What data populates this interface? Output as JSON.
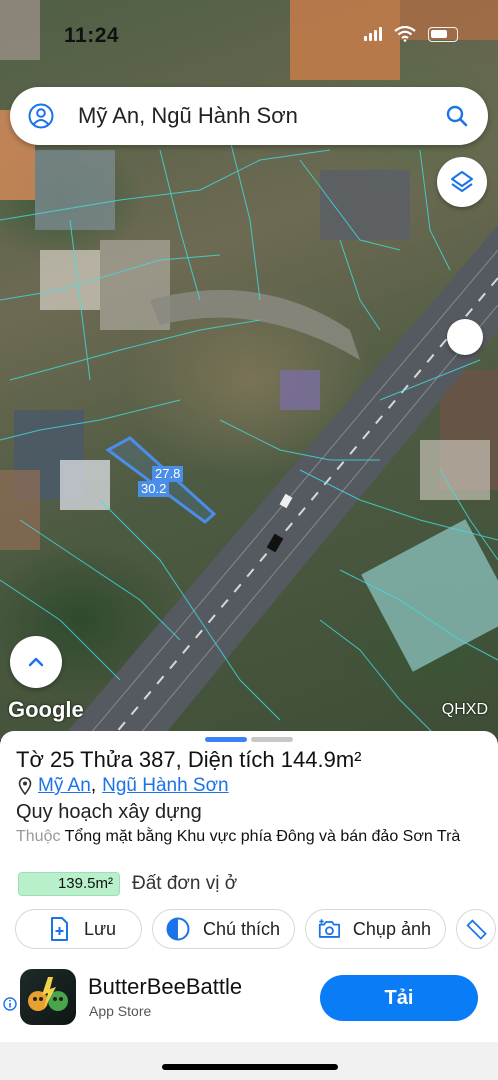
{
  "status_bar": {
    "time": "11:24"
  },
  "search": {
    "query": "Mỹ An, Ngũ Hành Sơn"
  },
  "map": {
    "measure_labels": [
      "27.8",
      "30.2"
    ],
    "attribution": "Google",
    "layer_label": "QHXD"
  },
  "parcel": {
    "title": "Tờ 25 Thửa 387, Diện tích 144.9m²",
    "ward": "Mỹ An",
    "district": "Ngũ Hành Sơn",
    "location_separator": ","
  },
  "planning": {
    "heading": "Quy hoạch xây dựng",
    "desc_prefix": "Thuộc",
    "desc_text": "Tổng mặt bằng Khu vực phía Đông và bán đảo Sơn Trà",
    "area_value": "139.5m²",
    "area_label": "Đất đơn vị ở",
    "area_color": "#b8f0cc"
  },
  "actions": [
    {
      "label": "Lưu",
      "icon": "file-plus-icon"
    },
    {
      "label": "Chú thích",
      "icon": "half-circle-icon"
    },
    {
      "label": "Chụp ảnh",
      "icon": "camera-plus-icon"
    },
    {
      "label": "",
      "icon": "ruler-icon"
    }
  ],
  "ad": {
    "title": "ButterBeeBattle",
    "subtitle": "App Store",
    "cta": "Tải",
    "cta_color": "#0a7cf5"
  },
  "colors": {
    "accent": "#1a73e8",
    "parcel_outline": "#4a8ee8",
    "cadastral_lines": "#3fe0e0"
  }
}
